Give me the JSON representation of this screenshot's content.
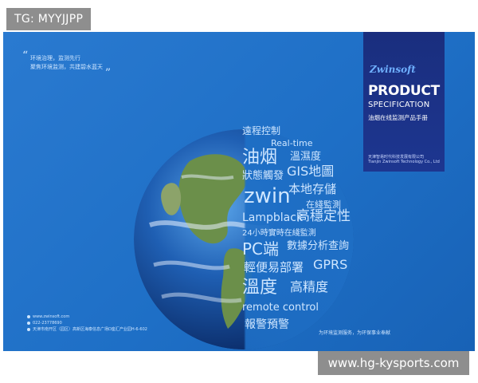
{
  "tag": {
    "label": "TG: MYYJJPP"
  },
  "quote": {
    "line1": "环境治理，监测先行",
    "line2": "聚焦环境监测，共建碧水蓝天"
  },
  "product": {
    "logo": "Zwinsoft",
    "title": "PRODUCT",
    "subtitle": "SPECIFICATION",
    "manual": "油烟在线监测产品手册",
    "company_cn": "天津智易时代科技发展有限公司",
    "company_en": "Tianjin Zwinsoft Technology Co., Ltd"
  },
  "cloud": {
    "w1": "遠程控制",
    "w2": "Real-time",
    "w3": "油烟",
    "w4": "溫濕度",
    "w5": "狀態觸發",
    "w6": "GIS地圖",
    "w7": "zwin",
    "w8": "本地存儲",
    "w9": "在綫監測",
    "w10": "Lampblack",
    "w11": "高穩定性",
    "w12": "24小時實時在綫監測",
    "w13": "PC端",
    "w14": "數據分析查詢",
    "w15": "輕便易部署",
    "w16": "GPRS",
    "w17": "溫度",
    "w18": "高精度",
    "w19": "remote control",
    "w20": "報警預警"
  },
  "contacts": {
    "web": "www.zwinsoft.com",
    "phone": "022-23778690",
    "address": "天津市南开区（园区）高新区海泰信息广场D座汇产业园H-6-602"
  },
  "footer": {
    "slogan": "为环境监测服务，为环保事业奉献"
  },
  "watermark": {
    "label": "www.hg-kysports.com"
  },
  "colors": {
    "panel_blue": "#1e6fc6",
    "product_box": "#1a2e7e",
    "text_light": "#cfe6ff",
    "overlay_gray": "#8e8e8e"
  }
}
